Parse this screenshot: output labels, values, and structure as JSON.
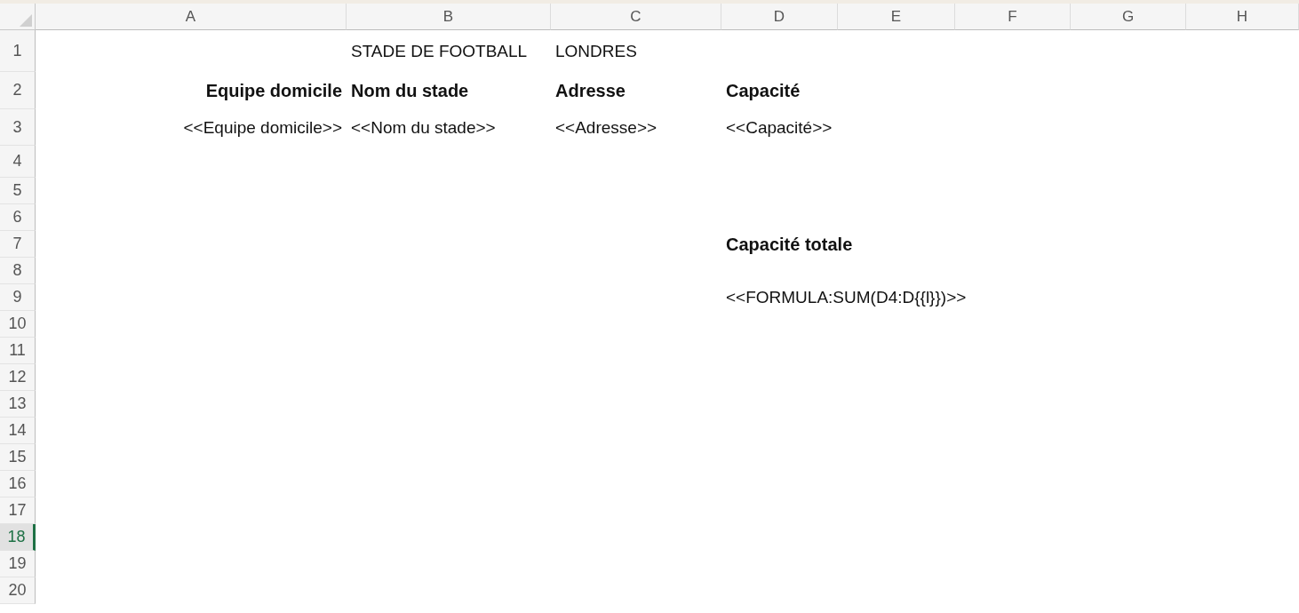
{
  "columns": [
    "A",
    "B",
    "C",
    "D",
    "E",
    "F",
    "G",
    "H"
  ],
  "rows": [
    {
      "number": "1",
      "selected": false,
      "cells": [
        null,
        {
          "text": "STADE DE FOOTBALL",
          "bold": false,
          "right_aligned": false
        },
        {
          "text": "LONDRES",
          "bold": false,
          "right_aligned": false
        }
      ]
    },
    {
      "number": "2",
      "selected": false,
      "cells": [
        {
          "text": "Equipe domicile",
          "bold": true,
          "right_aligned": true
        },
        {
          "text": "Nom du stade",
          "bold": true,
          "right_aligned": false
        },
        {
          "text": "Adresse",
          "bold": true,
          "right_aligned": false
        },
        {
          "text": "Capacité",
          "bold": true,
          "right_aligned": false
        }
      ]
    },
    {
      "number": "3",
      "selected": false,
      "cells": [
        {
          "text": "<<Equipe domicile>>",
          "bold": false,
          "right_aligned": true
        },
        {
          "text": "<<Nom du stade>>",
          "bold": false,
          "right_aligned": false
        },
        {
          "text": "<<Adresse>>",
          "bold": false,
          "right_aligned": false
        },
        {
          "text": "<<Capacité>>",
          "bold": false,
          "right_aligned": false
        }
      ]
    },
    {
      "number": "4",
      "selected": false
    },
    {
      "number": "5",
      "selected": false
    },
    {
      "number": "6",
      "selected": false
    },
    {
      "number": "7",
      "selected": false,
      "cells": [
        null,
        null,
        null,
        {
          "text": "Capacité totale",
          "bold": true,
          "right_aligned": false
        }
      ]
    },
    {
      "number": "8",
      "selected": false
    },
    {
      "number": "9",
      "selected": false,
      "cells": [
        null,
        null,
        null,
        {
          "text": "<<FORMULA:SUM(D4:D{{l}})>>",
          "bold": false,
          "right_aligned": false
        }
      ]
    },
    {
      "number": "10",
      "selected": false
    },
    {
      "number": "11",
      "selected": false
    },
    {
      "number": "12",
      "selected": false
    },
    {
      "number": "13",
      "selected": false
    },
    {
      "number": "14",
      "selected": false
    },
    {
      "number": "15",
      "selected": false
    },
    {
      "number": "16",
      "selected": false
    },
    {
      "number": "17",
      "selected": false
    },
    {
      "number": "18",
      "selected": true
    },
    {
      "number": "19",
      "selected": false
    },
    {
      "number": "20",
      "selected": false
    }
  ]
}
